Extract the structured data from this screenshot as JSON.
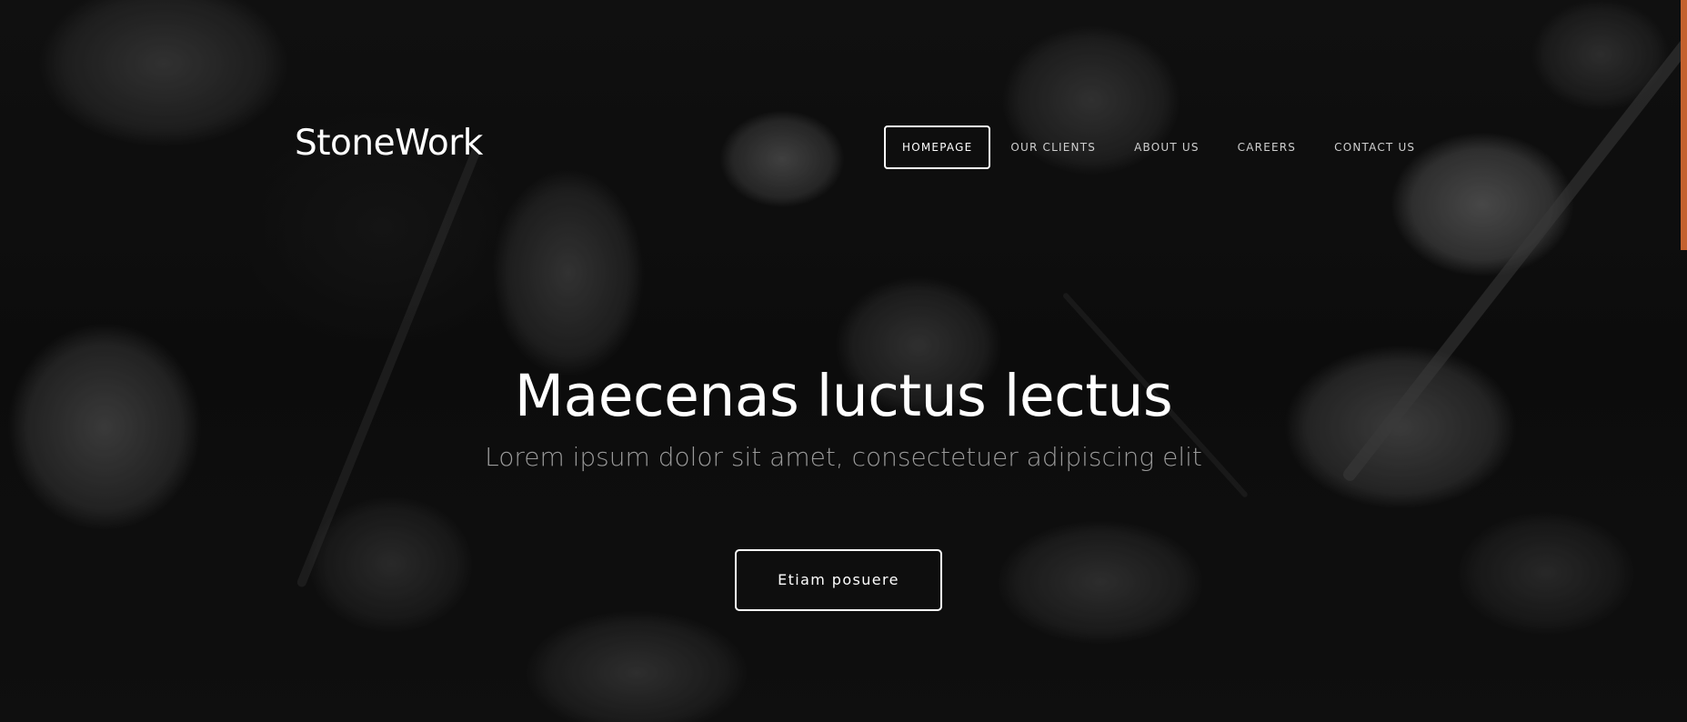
{
  "brand": {
    "name": "StoneWork"
  },
  "nav": {
    "items": [
      {
        "label": "HOMEPAGE",
        "active": true
      },
      {
        "label": "OUR CLIENTS",
        "active": false
      },
      {
        "label": "ABOUT US",
        "active": false
      },
      {
        "label": "CAREERS",
        "active": false
      },
      {
        "label": "CONTACT US",
        "active": false
      }
    ]
  },
  "hero": {
    "title": "Maecenas luctus lectus",
    "subtitle": "Lorem ipsum dolor sit amet, consectetuer adipiscing elit",
    "cta_label": "Etiam posuere",
    "background": "dark-rocks-image"
  },
  "colors": {
    "accent": "#c4612f",
    "text": "#ffffff",
    "subtitle": "#9a9a9a"
  }
}
